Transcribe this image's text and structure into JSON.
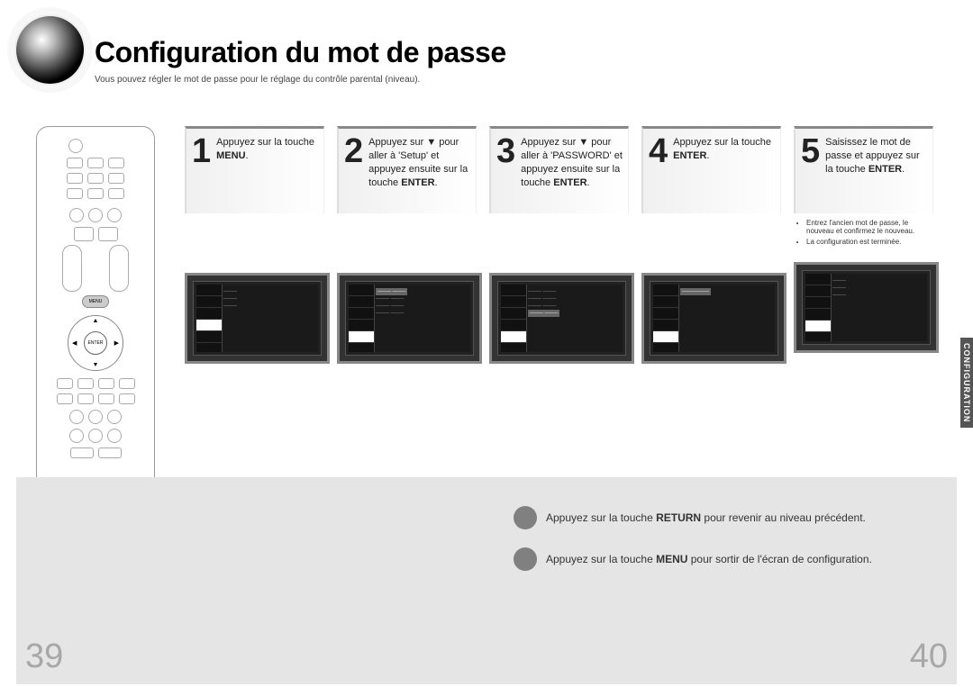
{
  "header": {
    "title": "Configuration du mot de passe",
    "subtitle": "Vous pouvez régler le mot de passe pour le réglage du contrôle parental (niveau)."
  },
  "steps": [
    {
      "num": "1",
      "text_pre": "Appuyez sur la touche ",
      "text_bold": "MENU",
      "text_post": "."
    },
    {
      "num": "2",
      "text_pre": "Appuyez sur ▼ pour aller à 'Setup' et appuyez ensuite sur la touche ",
      "text_bold": "ENTER",
      "text_post": "."
    },
    {
      "num": "3",
      "text_pre": "Appuyez sur ▼ pour aller à 'PASSWORD' et appuyez ensuite sur la touche ",
      "text_bold": "ENTER",
      "text_post": "."
    },
    {
      "num": "4",
      "text_pre": "Appuyez sur la touche ",
      "text_bold": "ENTER",
      "text_post": "."
    },
    {
      "num": "5",
      "text_pre": "Saisissez le mot de passe et appuyez sur la touche ",
      "text_bold": "ENTER",
      "text_post": ".",
      "notes": [
        "Entrez l'ancien mot de passe, le nouveau et confirmez le nouveau.",
        "La configuration est terminée."
      ]
    }
  ],
  "sidebar_tab": "CONFIGURATION",
  "footer": {
    "line1_pre": "Appuyez sur la touche ",
    "line1_bold": "RETURN",
    "line1_post": " pour revenir au niveau précédent.",
    "line2_pre": "Appuyez sur la touche ",
    "line2_bold": "MENU",
    "line2_post": " pour sortir de l'écran de configuration."
  },
  "page_left": "39",
  "page_right": "40",
  "remote": {
    "enter_label": "ENTER",
    "menu_label": "MENU"
  }
}
